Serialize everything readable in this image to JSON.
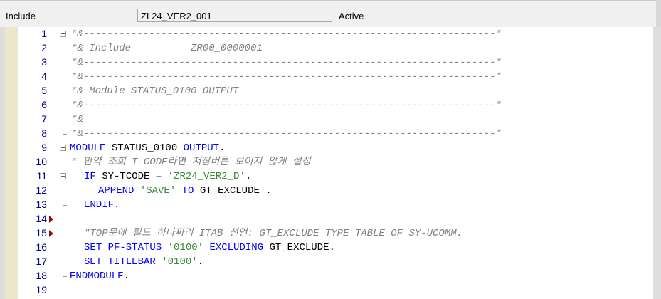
{
  "header": {
    "include_label": "Include",
    "include_value": "ZL24_VER2_001",
    "status": "Active"
  },
  "editor": {
    "lines": [
      {
        "num": "1",
        "parts": [
          {
            "t": "*&---------------------------------------------------------------------*",
            "k": "comment"
          }
        ]
      },
      {
        "num": "2",
        "parts": [
          {
            "t": "*& Include          ZR00_0000001",
            "k": "comment"
          }
        ]
      },
      {
        "num": "3",
        "parts": [
          {
            "t": "*&---------------------------------------------------------------------*",
            "k": "comment"
          }
        ]
      },
      {
        "num": "4",
        "parts": [
          {
            "t": "*&---------------------------------------------------------------------*",
            "k": "comment"
          }
        ]
      },
      {
        "num": "5",
        "parts": [
          {
            "t": "*& Module STATUS_0100 OUTPUT",
            "k": "comment"
          }
        ]
      },
      {
        "num": "6",
        "parts": [
          {
            "t": "*&---------------------------------------------------------------------*",
            "k": "comment"
          }
        ]
      },
      {
        "num": "7",
        "parts": [
          {
            "t": "*&",
            "k": "comment"
          }
        ]
      },
      {
        "num": "8",
        "parts": [
          {
            "t": "*&---------------------------------------------------------------------*",
            "k": "comment"
          }
        ]
      },
      {
        "num": "9",
        "parts": [
          {
            "t": "MODULE",
            "k": "kw"
          },
          {
            "t": " STATUS_0100 ",
            "k": "plain"
          },
          {
            "t": "OUTPUT",
            "k": "kw"
          },
          {
            "t": ".",
            "k": "plain"
          }
        ]
      },
      {
        "num": "10",
        "parts": [
          {
            "t": "* 만약 조회 T-CODE라면 저장버튼 보이지 않게 설정",
            "k": "comment"
          }
        ]
      },
      {
        "num": "11",
        "parts": [
          {
            "t": "IF",
            "k": "kw"
          },
          {
            "t": " SY-TCODE ",
            "k": "plain"
          },
          {
            "t": "=",
            "k": "kw"
          },
          {
            "t": " ",
            "k": "plain"
          },
          {
            "t": "'ZR24_VER2_D'",
            "k": "str"
          },
          {
            "t": ".",
            "k": "plain"
          }
        ]
      },
      {
        "num": "12",
        "parts": [
          {
            "t": "APPEND",
            "k": "kw"
          },
          {
            "t": " ",
            "k": "plain"
          },
          {
            "t": "'SAVE'",
            "k": "str"
          },
          {
            "t": " ",
            "k": "plain"
          },
          {
            "t": "TO",
            "k": "kw"
          },
          {
            "t": " GT_EXCLUDE .",
            "k": "plain"
          }
        ]
      },
      {
        "num": "13",
        "parts": [
          {
            "t": "ENDIF",
            "k": "kw"
          },
          {
            "t": ".",
            "k": "plain"
          }
        ]
      },
      {
        "num": "14",
        "parts": []
      },
      {
        "num": "15",
        "parts": [
          {
            "t": "\"TOP문에 필드 하나짜리 ITAB 선언: GT_EXCLUDE TYPE TABLE OF SY-UCOMM.",
            "k": "comment"
          }
        ]
      },
      {
        "num": "16",
        "parts": [
          {
            "t": "SET PF-STATUS",
            "k": "kw"
          },
          {
            "t": " ",
            "k": "plain"
          },
          {
            "t": "'0100'",
            "k": "str"
          },
          {
            "t": " ",
            "k": "plain"
          },
          {
            "t": "EXCLUDING",
            "k": "kw"
          },
          {
            "t": " GT_EXCLUDE.",
            "k": "plain"
          }
        ]
      },
      {
        "num": "17",
        "parts": [
          {
            "t": "SET TITLEBAR",
            "k": "kw"
          },
          {
            "t": " ",
            "k": "plain"
          },
          {
            "t": "'0100'",
            "k": "str"
          },
          {
            "t": ".",
            "k": "plain"
          }
        ]
      },
      {
        "num": "18",
        "parts": [
          {
            "t": "ENDMODULE",
            "k": "kw"
          },
          {
            "t": ".",
            "k": "plain"
          }
        ]
      },
      {
        "num": "19",
        "parts": []
      }
    ]
  }
}
